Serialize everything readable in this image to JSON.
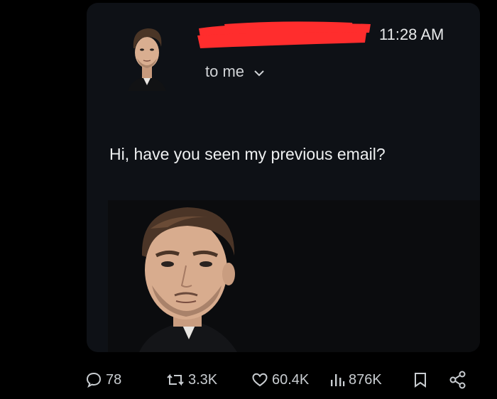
{
  "email": {
    "timestamp": "11:28 AM",
    "recipient_label": "to me",
    "body": "Hi, have you seen my previous email?"
  },
  "actions": {
    "replies": "78",
    "reposts": "3.3K",
    "likes": "60.4K",
    "views": "876K"
  },
  "icons": [
    "comment-icon",
    "repost-icon",
    "heart-icon",
    "views-icon",
    "bookmark-icon",
    "share-icon",
    "chevron-down-icon"
  ],
  "colors": {
    "background": "#000000",
    "card": "#0e1116",
    "redaction": "#ff2d2d",
    "text": "#e7e9ea",
    "muted": "#c9cdd1"
  }
}
